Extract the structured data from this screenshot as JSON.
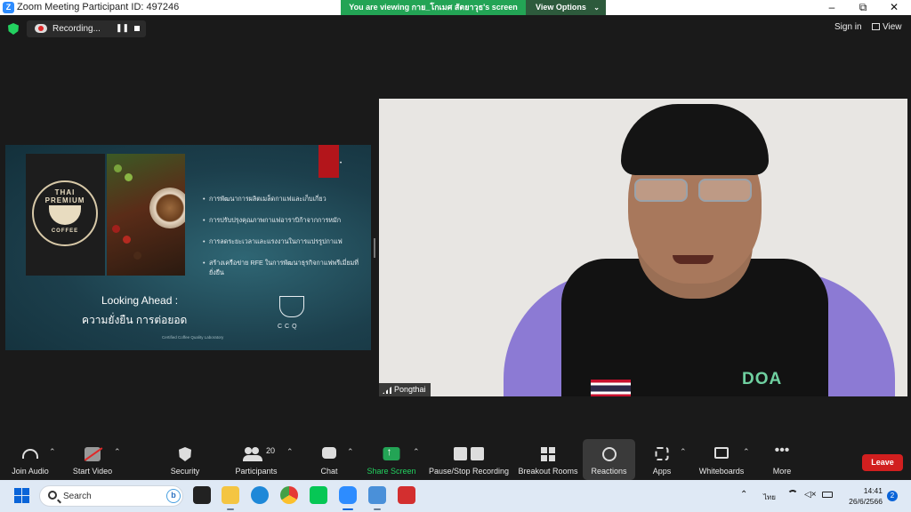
{
  "window": {
    "title": "Zoom Meeting Participant ID: 497246",
    "viewing_banner": "You are viewing กาย_โกเมศ สัตยาวุธ's screen",
    "view_options": "View Options"
  },
  "top_bar": {
    "recording_status": "Recording...",
    "sign_in": "Sign in",
    "view": "View"
  },
  "slide": {
    "logo_text_top": "THAI PREMIUM",
    "logo_text_bottom": "COFFEE",
    "bullets": [
      "การพัฒนาการผลิตเมล็ดกาแฟและเก็บเกี่ยว",
      "การปรับปรุงคุณภาพกาแฟอาราบิก้าจากการหมัก",
      "การลดระยะเวลาและแรงงานในการแปรรูปกาแฟ",
      "สร้างเครือข่าย RFE ในการพัฒนาธุรกิจกาแฟพรีเมี่ยมที่ยั่งยืน"
    ],
    "heading_1": "Looking Ahead :",
    "heading_2": "ความยั่งยืน การต่อยอด",
    "credit": "Certified Coffee Quality Laboratory",
    "ccq": "CCQ"
  },
  "video": {
    "participant_name": "Pongthai",
    "shirt_logo": "DOA"
  },
  "toolbar": {
    "join_audio": "Join Audio",
    "start_video": "Start Video",
    "security": "Security",
    "participants": "Participants",
    "participants_count": "20",
    "chat": "Chat",
    "share_screen": "Share Screen",
    "pause_stop_recording": "Pause/Stop Recording",
    "breakout_rooms": "Breakout Rooms",
    "reactions": "Reactions",
    "apps": "Apps",
    "whiteboards": "Whiteboards",
    "more": "More",
    "leave": "Leave"
  },
  "taskbar": {
    "search_placeholder": "Search",
    "language": "ไทย",
    "time": "14:41",
    "date": "26/6/2566",
    "notification_count": "2"
  },
  "colors": {
    "zoom_blue": "#2d8cff",
    "share_green": "#23d160",
    "leave_red": "#d11f1f",
    "slide_teal": "#1c3f4c"
  }
}
